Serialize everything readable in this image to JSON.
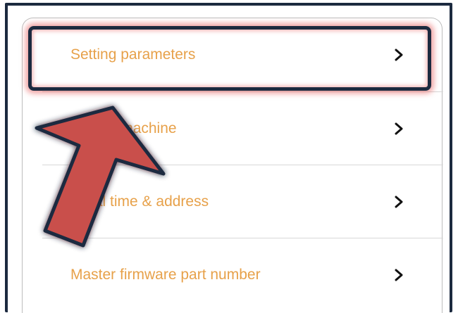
{
  "menu": {
    "items": [
      {
        "label": "Setting parameters",
        "chevron": "chevron-right-icon"
      },
      {
        "label": "Pairing machine",
        "chevron": "chevron-right-icon"
      },
      {
        "label": "Local time & address",
        "chevron": "chevron-right-icon"
      },
      {
        "label": "Master firmware part number",
        "chevron": "chevron-right-icon"
      }
    ]
  },
  "annotation": {
    "highlight_target": "Setting parameters",
    "highlight_color": "#1c2a3f",
    "arrow_color": "#c9504b"
  },
  "colors": {
    "label_text": "#e7a14a",
    "frame": "#1c2a3f",
    "divider": "#d7d7d7"
  }
}
